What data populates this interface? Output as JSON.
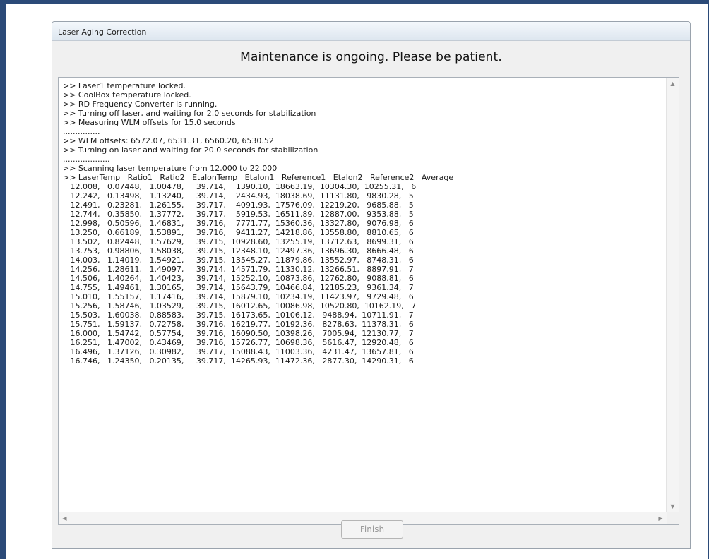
{
  "window": {
    "title": "Laser Aging Correction"
  },
  "banner": {
    "message": "Maintenance is ongoing. Please be patient."
  },
  "log": {
    "lines": [
      ">> Laser1 temperature locked.",
      ">> CoolBox temperature locked.",
      ">> RD Frequency Converter is running.",
      ">> Turning off laser, and waiting for 2.0 seconds for stabilization",
      ">> Measuring WLM offsets for 15.0 seconds",
      "...............",
      ">> WLM offsets: 6572.07, 6531.31, 6560.20, 6530.52",
      ">> Turning on laser and waiting for 20.0 seconds for stabilization",
      "...................",
      ">> Scanning laser temperature from 12.000 to 22.000",
      ">> LaserTemp   Ratio1   Ratio2   EtalonTemp   Etalon1   Reference1   Etalon2   Reference2   Average",
      "   12.008,   0.07448,   1.00478,     39.714,    1390.10,  18663.19,  10304.30,  10255.31,   6",
      "   12.242,   0.13498,   1.13240,     39.714,    2434.93,  18038.69,  11131.80,   9830.28,   5",
      "   12.491,   0.23281,   1.26155,     39.717,    4091.93,  17576.09,  12219.20,   9685.88,   5",
      "   12.744,   0.35850,   1.37772,     39.717,    5919.53,  16511.89,  12887.00,   9353.88,   5",
      "   12.998,   0.50596,   1.46831,     39.716,    7771.77,  15360.36,  13327.80,   9076.98,   6",
      "   13.250,   0.66189,   1.53891,     39.716,    9411.27,  14218.86,  13558.80,   8810.65,   6",
      "   13.502,   0.82448,   1.57629,     39.715,  10928.60,  13255.19,  13712.63,   8699.31,   6",
      "   13.753,   0.98806,   1.58038,     39.715,  12348.10,  12497.36,  13696.30,   8666.48,   6",
      "   14.003,   1.14019,   1.54921,     39.715,  13545.27,  11879.86,  13552.97,   8748.31,   6",
      "   14.256,   1.28611,   1.49097,     39.714,  14571.79,  11330.12,  13266.51,   8897.91,   7",
      "   14.506,   1.40264,   1.40423,     39.714,  15252.10,  10873.86,  12762.80,   9088.81,   6",
      "   14.755,   1.49461,   1.30165,     39.714,  15643.79,  10466.84,  12185.23,   9361.34,   7",
      "   15.010,   1.55157,   1.17416,     39.714,  15879.10,  10234.19,  11423.97,   9729.48,   6",
      "   15.256,   1.58746,   1.03529,     39.715,  16012.65,  10086.98,  10520.80,  10162.19,   7",
      "   15.503,   1.60038,   0.88583,     39.715,  16173.65,  10106.12,   9488.94,  10711.91,   7",
      "   15.751,   1.59137,   0.72758,     39.716,  16219.77,  10192.36,   8278.63,  11378.31,   6",
      "   16.000,   1.54742,   0.57754,     39.716,  16090.50,  10398.26,   7005.94,  12130.77,   7",
      "   16.251,   1.47002,   0.43469,     39.716,  15726.77,  10698.36,   5616.47,  12920.48,   6",
      "   16.496,   1.37126,   0.30982,     39.717,  15088.43,  11003.36,   4231.47,  13657.81,   6",
      "   16.746,   1.24350,   0.20135,     39.717,  14265.93,  11472.36,   2877.30,  14290.31,   6"
    ]
  },
  "buttons": {
    "finish_label": "Finish"
  },
  "scrollbars": {
    "up_arrow": "▲",
    "down_arrow": "▼",
    "left_arrow": "◀",
    "right_arrow": "▶"
  }
}
